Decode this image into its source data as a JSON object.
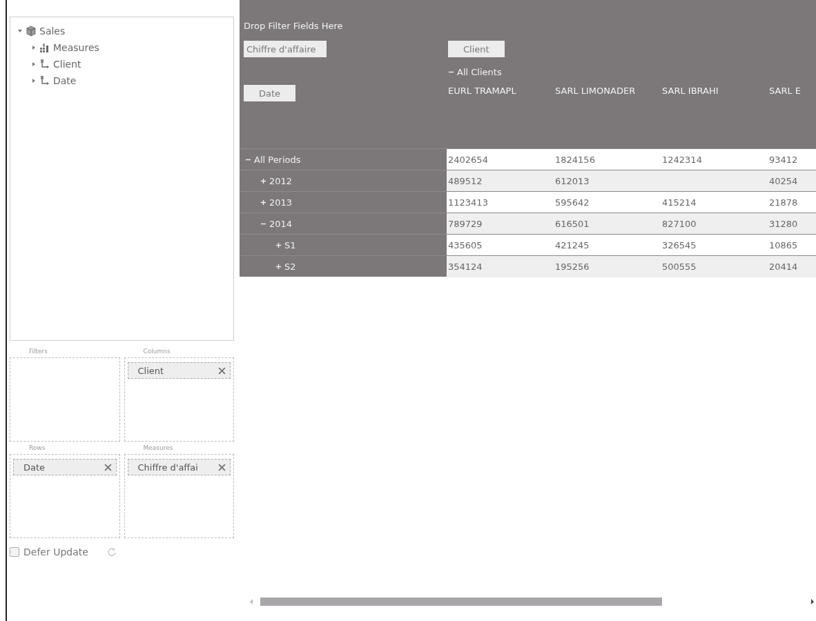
{
  "field_tree": {
    "label": "Sales",
    "expanded": true,
    "children": [
      {
        "label": "Measures",
        "kind": "measures",
        "expanded": false
      },
      {
        "label": "Client",
        "kind": "dimension",
        "expanded": false
      },
      {
        "label": "Date",
        "kind": "dimension",
        "expanded": false
      }
    ]
  },
  "areas": [
    {
      "title": "Filters"
    },
    {
      "title": "Columns",
      "fields": [
        "Client"
      ]
    },
    {
      "title": "Rows",
      "fields": [
        "Date"
      ]
    },
    {
      "title": "Measures",
      "fields": [
        "Chiffre d'affai"
      ]
    }
  ],
  "defer_update": {
    "label": "Defer Update",
    "checked": false
  },
  "pivot": {
    "filter_hint": "Drop Filter Fields Here",
    "data_field": "Chiffre d'affaire",
    "row_field": "Date",
    "column_field": "Client",
    "column_root": {
      "label": "All Clients",
      "expanded": true
    },
    "columns": [
      "EURL TRAMAPL",
      "SARL LIMONADER",
      "SARL IBRAHI",
      "SARL E"
    ],
    "rows": [
      {
        "label": "All Periods",
        "expanded": true,
        "values": {
          "column_1": "2402654",
          "column_2": "1824156",
          "column_3": "1242314",
          "column_4": "93412"
        },
        "children": [
          {
            "label": "2012",
            "expanded": false,
            "values": {
              "column_1": "489512",
              "column_2": "612013",
              "column_4": "40254"
            }
          },
          {
            "label": "2013",
            "expanded": false,
            "values": {
              "column_1": "1123413",
              "column_2": "595642",
              "column_3": "415214",
              "column_4": "21878"
            }
          },
          {
            "label": "2014",
            "expanded": true,
            "values": {
              "column_1": "789729",
              "column_2": "616501",
              "column_3": "827100",
              "column_4": "31280"
            },
            "children": [
              {
                "label": "S1",
                "expanded": false,
                "values": {
                  "column_1": "435605",
                  "column_2": "421245",
                  "column_3": "326545",
                  "column_4": "10865"
                }
              },
              {
                "label": "S2",
                "expanded": false,
                "values": {
                  "column_1": "354124",
                  "column_2": "195256",
                  "column_3": "500555",
                  "column_4": "20414"
                }
              }
            ]
          }
        ]
      }
    ]
  }
}
